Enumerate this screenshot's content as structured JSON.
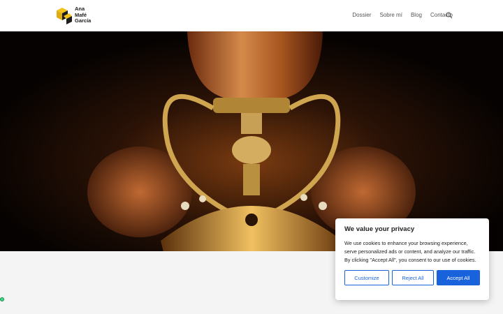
{
  "header": {
    "logo_lines": [
      "Ana",
      "Mafé",
      "García"
    ],
    "nav": [
      "Dossier",
      "Sobre mí",
      "Blog",
      "Contacto"
    ],
    "search_icon": "search-icon"
  },
  "hero": {
    "image": "golden-chalice-in-hands"
  },
  "cookie": {
    "title": "We value your privacy",
    "body": "We use cookies to enhance your browsing experience, serve personalized ads or content, and analyze our traffic. By clicking \"Accept All\", you consent to our use of cookies.",
    "customize": "Customize",
    "reject": "Reject All",
    "accept": "Accept All",
    "accent": "#1863dc"
  }
}
